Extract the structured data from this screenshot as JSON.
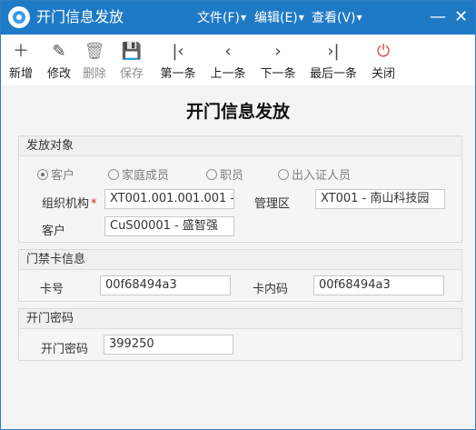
{
  "window": {
    "title": "开门信息发放",
    "minimize": "—",
    "close": "✕"
  },
  "menu": [
    {
      "label": "文件(F)"
    },
    {
      "label": "编辑(E)"
    },
    {
      "label": "查看(V)"
    }
  ],
  "toolbar": [
    {
      "label": "新增",
      "icon": "＋"
    },
    {
      "label": "修改",
      "icon": "✎"
    },
    {
      "label": "删除",
      "icon": "🗑"
    },
    {
      "label": "保存",
      "icon": "💾"
    },
    {
      "label": "第一条",
      "icon": "|‹"
    },
    {
      "label": "上一条",
      "icon": "‹"
    },
    {
      "label": "下一条",
      "icon": "›"
    },
    {
      "label": "最后一条",
      "icon": "›|"
    },
    {
      "label": "关闭",
      "icon": "⏻"
    }
  ],
  "form": {
    "title": "开门信息发放",
    "section1": {
      "title": "发放对象",
      "radios": [
        {
          "label": "客户",
          "selected": true
        },
        {
          "label": "家庭成员",
          "selected": false
        },
        {
          "label": "职员",
          "selected": false
        },
        {
          "label": "出入证人员",
          "selected": false
        }
      ],
      "org_label": "组织机构",
      "required_mark": "*",
      "org_value": "XT001.001.001.001 -",
      "area_label": "管理区",
      "area_value": "XT001 - 南山科技园",
      "customer_label": "客户",
      "customer_value": "CuS00001 - 盛智强"
    },
    "section2": {
      "title": "门禁卡信息",
      "card_no_label": "卡号",
      "card_no_value": "00f68494a3",
      "inner_no_label": "卡内码",
      "inner_no_value": "00f68494a3"
    },
    "section3": {
      "title": "开门密码",
      "password_label": "开门密码",
      "password_value": "399250"
    }
  }
}
